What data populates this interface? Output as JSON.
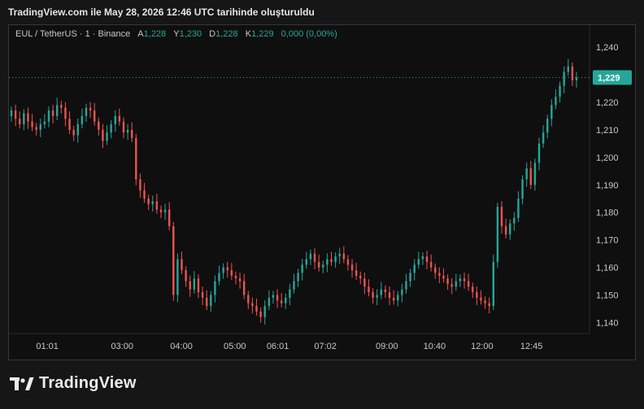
{
  "caption": "TradingView.com ile May 28, 2026 12:46 UTC tarihinde oluşturuldu",
  "legend": {
    "symbol": "EUL / TetherUS · 1 · Binance",
    "open_label": "A",
    "open_value": "1,228",
    "high_label": "Y",
    "high_value": "1,230",
    "low_label": "D",
    "low_value": "1,228",
    "close_label": "K",
    "close_value": "1,229",
    "change": "0,000 (0,00%)"
  },
  "price_label": "1,229",
  "brand": "TradingView",
  "colors": {
    "up": "#26a69a",
    "down": "#ef5350",
    "background": "#0f0f0f",
    "price_tag": "#26a69a"
  },
  "chart_data": {
    "type": "candlestick",
    "ylim": [
      1.136,
      1.248
    ],
    "y_ticks": [
      "1,240",
      "1,230",
      "1,220",
      "1,210",
      "1,200",
      "1,190",
      "1,180",
      "1,170",
      "1,160",
      "1,150",
      "1,140"
    ],
    "y_tick_values": [
      1.24,
      1.23,
      1.22,
      1.21,
      1.2,
      1.19,
      1.18,
      1.17,
      1.16,
      1.15,
      1.14
    ],
    "x_ticks": [
      "01:01",
      "03:00",
      "04:00",
      "05:00",
      "06:01",
      "07:02",
      "09:00",
      "10:40",
      "12:00",
      "12:45"
    ],
    "x_tick_pos": [
      0.066,
      0.195,
      0.297,
      0.389,
      0.463,
      0.545,
      0.651,
      0.733,
      0.815,
      0.9
    ],
    "last_price": 1.229,
    "close": [
      1.217,
      1.214,
      1.212,
      1.216,
      1.213,
      1.211,
      1.21,
      1.212,
      1.213,
      1.217,
      1.215,
      1.219,
      1.218,
      1.214,
      1.21,
      1.208,
      1.212,
      1.215,
      1.218,
      1.217,
      1.213,
      1.21,
      1.206,
      1.209,
      1.212,
      1.215,
      1.213,
      1.209,
      1.21,
      1.207,
      1.192,
      1.188,
      1.185,
      1.183,
      1.184,
      1.181,
      1.18,
      1.181,
      1.175,
      1.15,
      1.163,
      1.159,
      1.155,
      1.152,
      1.156,
      1.151,
      1.149,
      1.146,
      1.15,
      1.155,
      1.158,
      1.16,
      1.159,
      1.157,
      1.156,
      1.155,
      1.15,
      1.147,
      1.146,
      1.144,
      1.142,
      1.146,
      1.149,
      1.15,
      1.148,
      1.147,
      1.149,
      1.152,
      1.155,
      1.158,
      1.161,
      1.163,
      1.165,
      1.162,
      1.16,
      1.161,
      1.163,
      1.162,
      1.164,
      1.165,
      1.163,
      1.161,
      1.159,
      1.157,
      1.156,
      1.153,
      1.151,
      1.149,
      1.15,
      1.152,
      1.151,
      1.149,
      1.148,
      1.15,
      1.152,
      1.155,
      1.158,
      1.161,
      1.163,
      1.164,
      1.162,
      1.16,
      1.158,
      1.157,
      1.156,
      1.154,
      1.153,
      1.155,
      1.156,
      1.155,
      1.153,
      1.151,
      1.149,
      1.148,
      1.147,
      1.146,
      1.162,
      1.182,
      1.175,
      1.172,
      1.176,
      1.178,
      1.185,
      1.192,
      1.196,
      1.19,
      1.198,
      1.205,
      1.209,
      1.214,
      1.219,
      1.222,
      1.226,
      1.231,
      1.233,
      1.228,
      1.229
    ]
  }
}
